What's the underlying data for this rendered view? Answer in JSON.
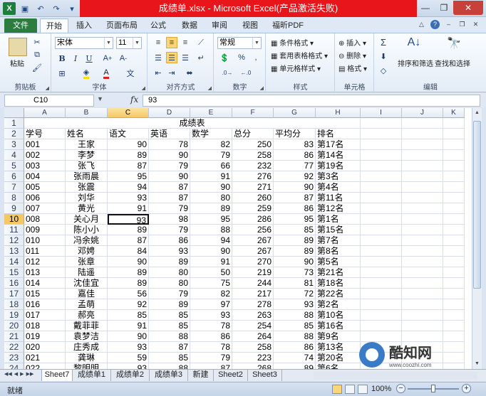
{
  "window": {
    "title": "成绩单.xlsx - Microsoft Excel(产品激活失败)"
  },
  "ribbon_tabs": [
    {
      "label": "文件"
    },
    {
      "label": "开始"
    },
    {
      "label": "插入"
    },
    {
      "label": "页面布局"
    },
    {
      "label": "公式"
    },
    {
      "label": "数据"
    },
    {
      "label": "审阅"
    },
    {
      "label": "视图"
    },
    {
      "label": "福昕PDF"
    }
  ],
  "ribbon": {
    "clipboard": {
      "paste": "粘贴",
      "label": "剪贴板"
    },
    "font": {
      "name": "宋体",
      "size": "11",
      "bold": "B",
      "italic": "I",
      "underline": "U",
      "label": "字体",
      "font_color": "#e02020",
      "fill_color": "#ffe000"
    },
    "alignment": {
      "label": "对齐方式"
    },
    "number": {
      "format": "常规",
      "percent": "%",
      "comma": ",",
      "label": "数字"
    },
    "styles": {
      "conditional": "条件格式",
      "table": "套用表格格式",
      "cell_styles": "单元格样式",
      "label": "样式"
    },
    "cells": {
      "insert": "插入",
      "delete": "删除",
      "format": "格式",
      "label": "单元格"
    },
    "editing": {
      "sum": "Σ",
      "sort": "排序和筛选",
      "find": "查找和选择",
      "label": "编辑"
    }
  },
  "formula_bar": {
    "name_box": "C10",
    "fx": "fx",
    "value": "93"
  },
  "grid": {
    "columns": [
      "A",
      "B",
      "C",
      "D",
      "E",
      "F",
      "G",
      "H",
      "I",
      "J",
      "K"
    ],
    "selected_column": "C",
    "selected_row": "10",
    "title_cell": "成绩表",
    "headers": [
      "学号",
      "姓名",
      "语文",
      "英语",
      "数学",
      "总分",
      "平均分",
      "排名"
    ],
    "rows": [
      [
        "001",
        "王家",
        "90",
        "78",
        "82",
        "250",
        "83",
        "第17名"
      ],
      [
        "002",
        "李梦",
        "89",
        "90",
        "79",
        "258",
        "86",
        "第14名"
      ],
      [
        "003",
        "张飞",
        "87",
        "79",
        "66",
        "232",
        "77",
        "第19名"
      ],
      [
        "004",
        "张雨晨",
        "95",
        "90",
        "91",
        "276",
        "92",
        "第3名"
      ],
      [
        "005",
        "张震",
        "94",
        "87",
        "90",
        "271",
        "90",
        "第4名"
      ],
      [
        "006",
        "刘华",
        "93",
        "87",
        "80",
        "260",
        "87",
        "第11名"
      ],
      [
        "007",
        "黄光",
        "91",
        "79",
        "89",
        "259",
        "86",
        "第12名"
      ],
      [
        "008",
        "关心月",
        "93",
        "98",
        "95",
        "286",
        "95",
        "第1名"
      ],
      [
        "009",
        "陈小小",
        "89",
        "79",
        "88",
        "256",
        "85",
        "第15名"
      ],
      [
        "010",
        "冯余姚",
        "87",
        "86",
        "94",
        "267",
        "89",
        "第7名"
      ],
      [
        "011",
        "邓娉",
        "84",
        "93",
        "90",
        "267",
        "89",
        "第8名"
      ],
      [
        "012",
        "张章",
        "90",
        "89",
        "91",
        "270",
        "90",
        "第5名"
      ],
      [
        "013",
        "陆遥",
        "89",
        "80",
        "50",
        "219",
        "73",
        "第21名"
      ],
      [
        "014",
        "沈佳宜",
        "89",
        "80",
        "75",
        "244",
        "81",
        "第18名"
      ],
      [
        "015",
        "嘉佳",
        "56",
        "79",
        "82",
        "217",
        "72",
        "第22名"
      ],
      [
        "016",
        "孟萌",
        "92",
        "89",
        "97",
        "278",
        "93",
        "第2名"
      ],
      [
        "017",
        "郝亮",
        "85",
        "85",
        "93",
        "263",
        "88",
        "第10名"
      ],
      [
        "018",
        "戴菲菲",
        "91",
        "85",
        "78",
        "254",
        "85",
        "第16名"
      ],
      [
        "019",
        "袁梦洁",
        "90",
        "88",
        "86",
        "264",
        "88",
        "第9名"
      ],
      [
        "020",
        "庄秀成",
        "93",
        "87",
        "78",
        "258",
        "86",
        "第13名"
      ],
      [
        "021",
        "龚琳",
        "59",
        "85",
        "79",
        "223",
        "74",
        "第20名"
      ],
      [
        "022",
        "黎明明",
        "93",
        "88",
        "87",
        "268",
        "89",
        "第6名"
      ]
    ]
  },
  "sheet_tabs": [
    "Sheet7",
    "成绩单1",
    "成绩单2",
    "成绩单3",
    "新建",
    "Sheet2",
    "Sheet3"
  ],
  "active_sheet": "Sheet7",
  "status": {
    "ready": "就绪",
    "zoom": "100%"
  },
  "watermark": {
    "title": "酷知网",
    "url": "www.coozhi.com"
  }
}
